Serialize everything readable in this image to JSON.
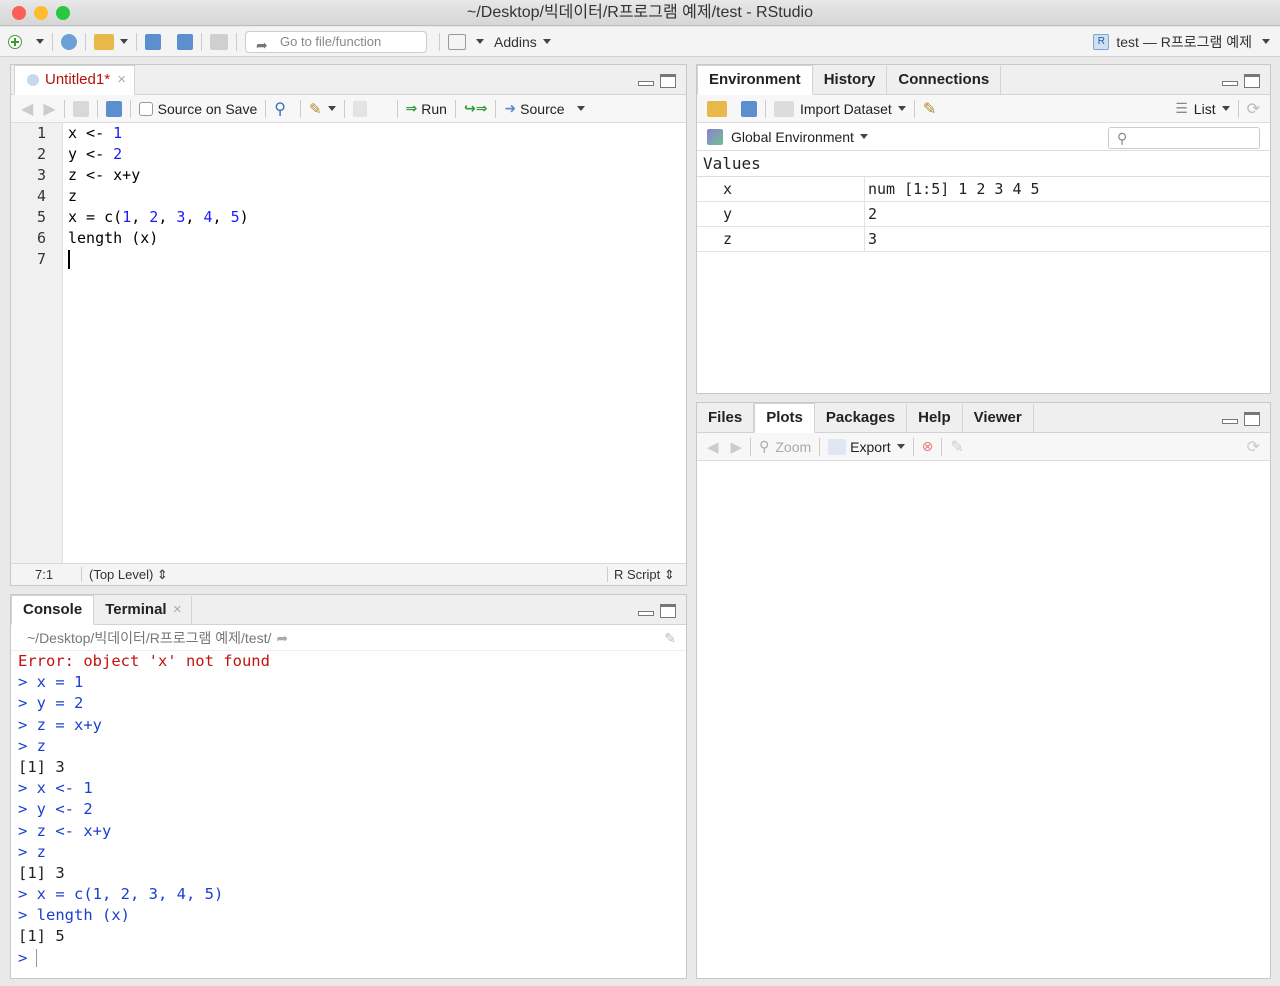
{
  "window": {
    "title": "~/Desktop/빅데이터/R프로그램 예제/test - RStudio"
  },
  "toolbar": {
    "goto_placeholder": "Go to file/function",
    "addins": "Addins",
    "project": "test — R프로그램 예제"
  },
  "editor": {
    "tab": "Untitled1*",
    "source_on_save": "Source on Save",
    "run": "Run",
    "source": "Source",
    "line_numbers": [
      "1",
      "2",
      "3",
      "4",
      "5",
      "6",
      "7"
    ],
    "status": {
      "position": "7:1",
      "scope": "(Top Level)",
      "type": "R Script"
    }
  },
  "console": {
    "tabs": [
      "Console",
      "Terminal"
    ],
    "path": "~/Desktop/빅데이터/R프로그램 예제/test/",
    "lines": [
      {
        "text": "Error: object 'x' not found",
        "kind": "error"
      },
      {
        "text": "> x = 1",
        "kind": "input"
      },
      {
        "text": "> y = 2",
        "kind": "input"
      },
      {
        "text": "> z = x+y",
        "kind": "input"
      },
      {
        "text": "> z",
        "kind": "input"
      },
      {
        "text": "[1] 3",
        "kind": "output"
      },
      {
        "text": "> x <- 1",
        "kind": "input"
      },
      {
        "text": "> y <- 2",
        "kind": "input"
      },
      {
        "text": "> z <- x+y",
        "kind": "input"
      },
      {
        "text": "> z",
        "kind": "input"
      },
      {
        "text": "[1] 3",
        "kind": "output"
      },
      {
        "text": "> x = c(1, 2, 3, 4, 5)",
        "kind": "input"
      },
      {
        "text": "> length (x)",
        "kind": "input"
      },
      {
        "text": "[1] 5",
        "kind": "output"
      },
      {
        "text": ">",
        "kind": "prompt"
      }
    ]
  },
  "environment": {
    "tabs": [
      "Environment",
      "History",
      "Connections"
    ],
    "import_dataset": "Import Dataset",
    "view_mode": "List",
    "scope": "Global Environment",
    "section": "Values",
    "rows": [
      {
        "name": "x",
        "value": "num [1:5] 1 2 3 4 5"
      },
      {
        "name": "y",
        "value": "2"
      },
      {
        "name": "z",
        "value": "3"
      }
    ]
  },
  "files": {
    "tabs": [
      "Files",
      "Plots",
      "Packages",
      "Help",
      "Viewer"
    ],
    "zoom": "Zoom",
    "export": "Export"
  },
  "colors": {
    "accent_error": "#c3120f",
    "console_input": "#1a3fd0",
    "number": "#1a1aff"
  }
}
